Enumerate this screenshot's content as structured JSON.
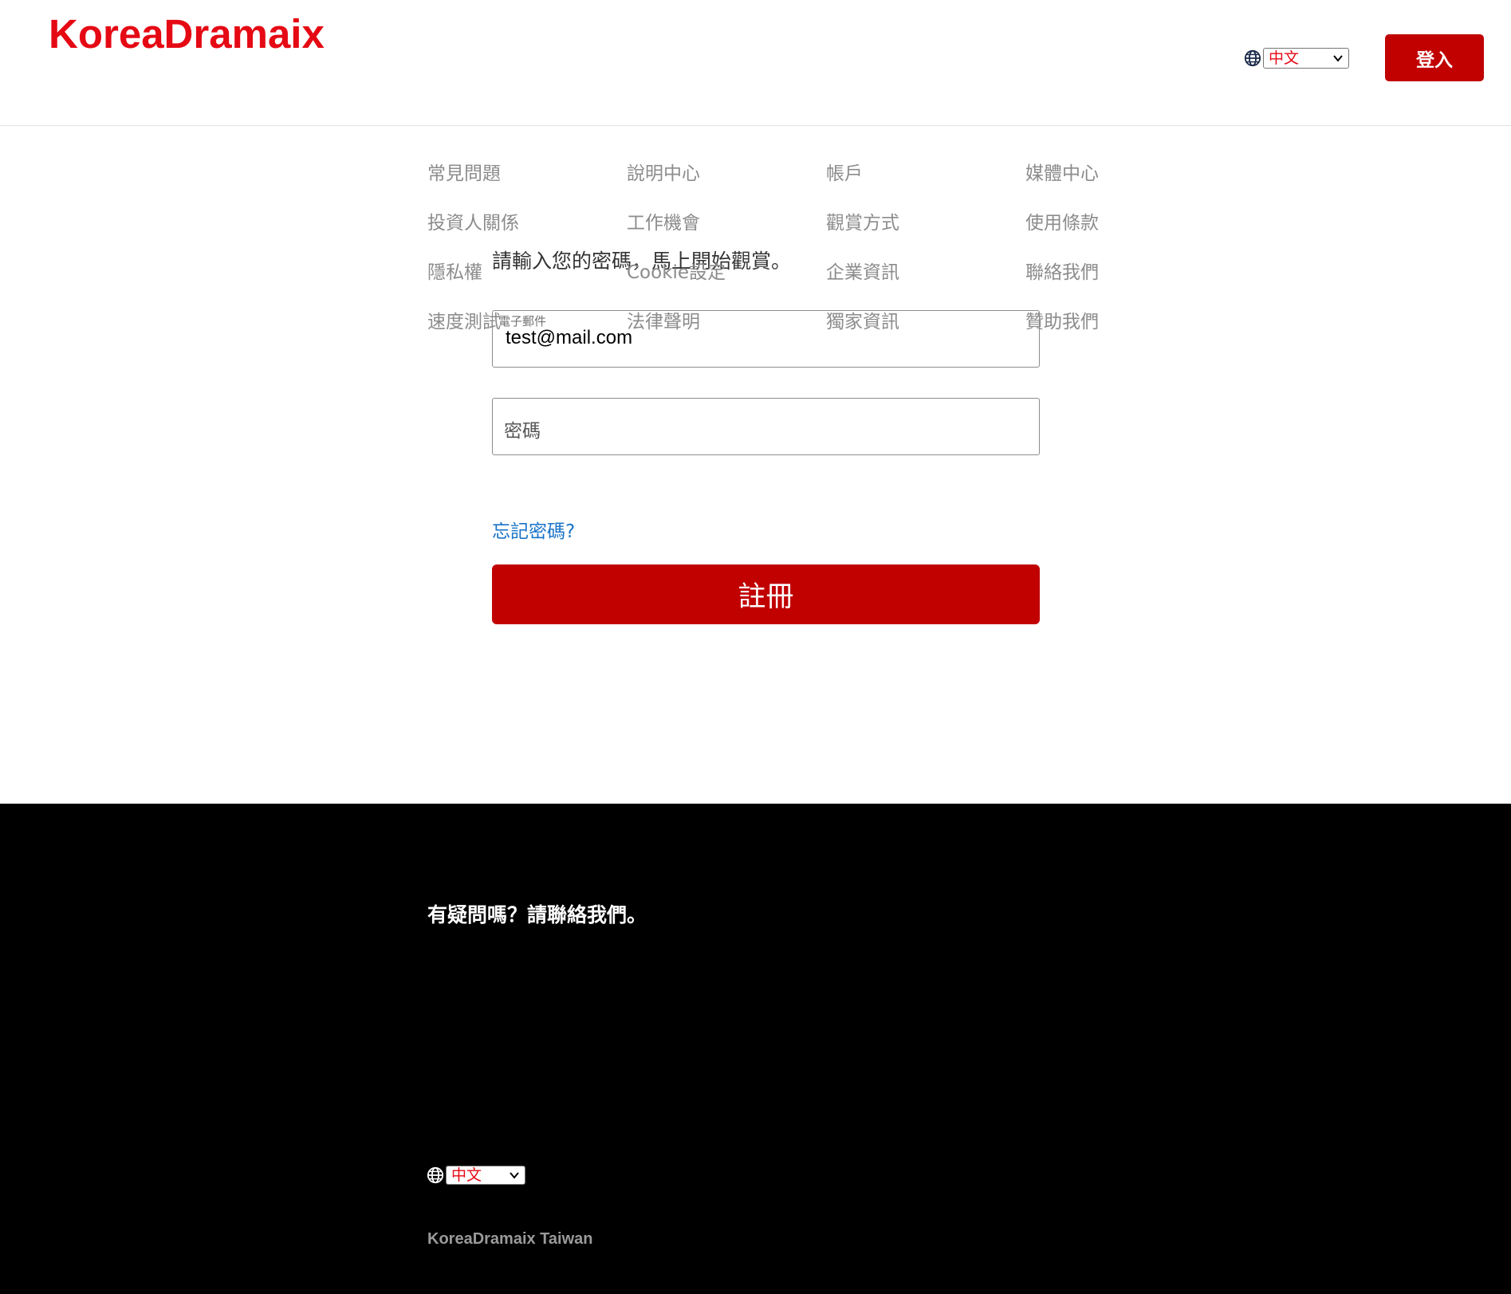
{
  "header": {
    "logo": "KoreaDramaix",
    "language": {
      "selected": "中文",
      "icon": "globe-icon"
    },
    "login_label": "登入"
  },
  "form": {
    "heading": "請輸入您的密碼，馬上開始觀賞。",
    "email": {
      "label": "電子郵件",
      "value": "test@mail.com"
    },
    "password": {
      "placeholder": "密碼"
    },
    "forgot_label": "忘記密碼?",
    "submit_label": "註冊"
  },
  "footer": {
    "question": "有疑問嗎？請聯絡我們。",
    "links": [
      "常見問題",
      "說明中心",
      "帳戶",
      "媒體中心",
      "投資人關係",
      "工作機會",
      "觀賞方式",
      "使用條款",
      "隱私權",
      "Cookie設定",
      "企業資訊",
      "聯絡我們",
      "速度測試",
      "法律聲明",
      "獨家資訊",
      "贊助我們"
    ],
    "language": {
      "selected": "中文",
      "icon": "globe-icon"
    },
    "brand": "KoreaDramaix Taiwan"
  },
  "colors": {
    "brand_red": "#e50914",
    "button_red": "#c10000",
    "link_blue": "#1a73c8",
    "footer_bg": "#000000"
  }
}
